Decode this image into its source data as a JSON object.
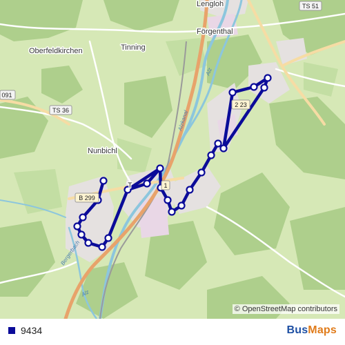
{
  "map": {
    "places": {
      "lengloh": "Lengloh",
      "oberfeldkirchen": "Oberfeldkirchen",
      "tinning": "Tinning",
      "foergenthal": "Förgenthal",
      "nunbichl": "Nunbichl",
      "town_fragment": "T"
    },
    "roads": {
      "ts51": "TS 51",
      "ts36": "TS 36",
      "b299": "B 299",
      "r091": "091",
      "t23": "2 23",
      "t1": "1"
    },
    "rivers": {
      "alz_north": "Alz",
      "alz_kanal": "Alzkanal",
      "alz_south": "Alz",
      "stream_sw": "Bergerbach"
    },
    "colors": {
      "route": "#0b0b99",
      "stop_fill": "#ffffff",
      "land": "#d8e8b8",
      "forest": "#a9cc87",
      "urban": "#e4e0e0",
      "industrial": "#e8d8e6",
      "water": "#8cc6dd",
      "motorway": "#e8a36b"
    }
  },
  "attribution": "© OpenStreetMap contributors",
  "legend": {
    "line": "9434",
    "color": "#0b0b99"
  },
  "brand": {
    "bus": "Bus",
    "maps": "Maps"
  }
}
